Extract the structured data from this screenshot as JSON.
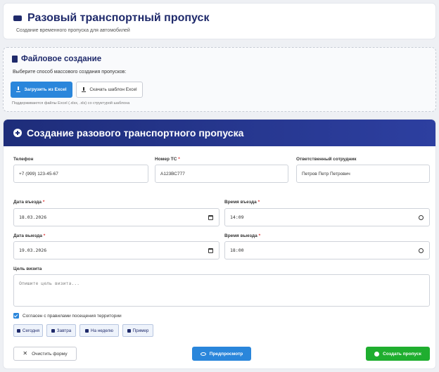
{
  "header": {
    "title": "Разовый транспортный пропуск",
    "subtitle": "Создание временного пропуска для автомобилей"
  },
  "file_section": {
    "title": "Файловое создание",
    "description": "Выберите способ массового создания пропусков:",
    "upload_label": "Загрузить из Excel",
    "download_label": "Скачать шаблон Excel",
    "hint": "Поддерживаются файлы Excel (.xlsx, .xls) со структурой шаблона"
  },
  "form": {
    "title": "Создание разового транспортного пропуска",
    "phone": {
      "label": "Телефон",
      "value": "+7 (999) 123-45-67"
    },
    "vehicle": {
      "label": "Номер ТС",
      "value": "А123ВС777"
    },
    "employee": {
      "label": "Ответственный сотрудник",
      "value": "Петров Петр Петрович"
    },
    "entry_date": {
      "label": "Дата въезда",
      "value": "18.03.2026"
    },
    "entry_time": {
      "label": "Время въезда",
      "value": "14:09"
    },
    "exit_date": {
      "label": "Дата выезда",
      "value": "19.03.2026"
    },
    "exit_time": {
      "label": "Время выезда",
      "value": "18:00"
    },
    "purpose": {
      "label": "Цель визита",
      "placeholder": "Опишите цель визита..."
    },
    "agree_label": "Согласен с правилами посещения территории",
    "agree_checked": true,
    "quick": [
      "Сегодня",
      "Завтра",
      "На неделю",
      "Пример"
    ],
    "clear_label": "Очистить форму",
    "preview_label": "Предпросмотр",
    "create_label": "Создать пропуск",
    "required_mark": "*"
  },
  "colors": {
    "accent": "#2a86db",
    "header_bg": "#1e2d7a",
    "success": "#1fae2f",
    "title": "#1f2a6b"
  }
}
